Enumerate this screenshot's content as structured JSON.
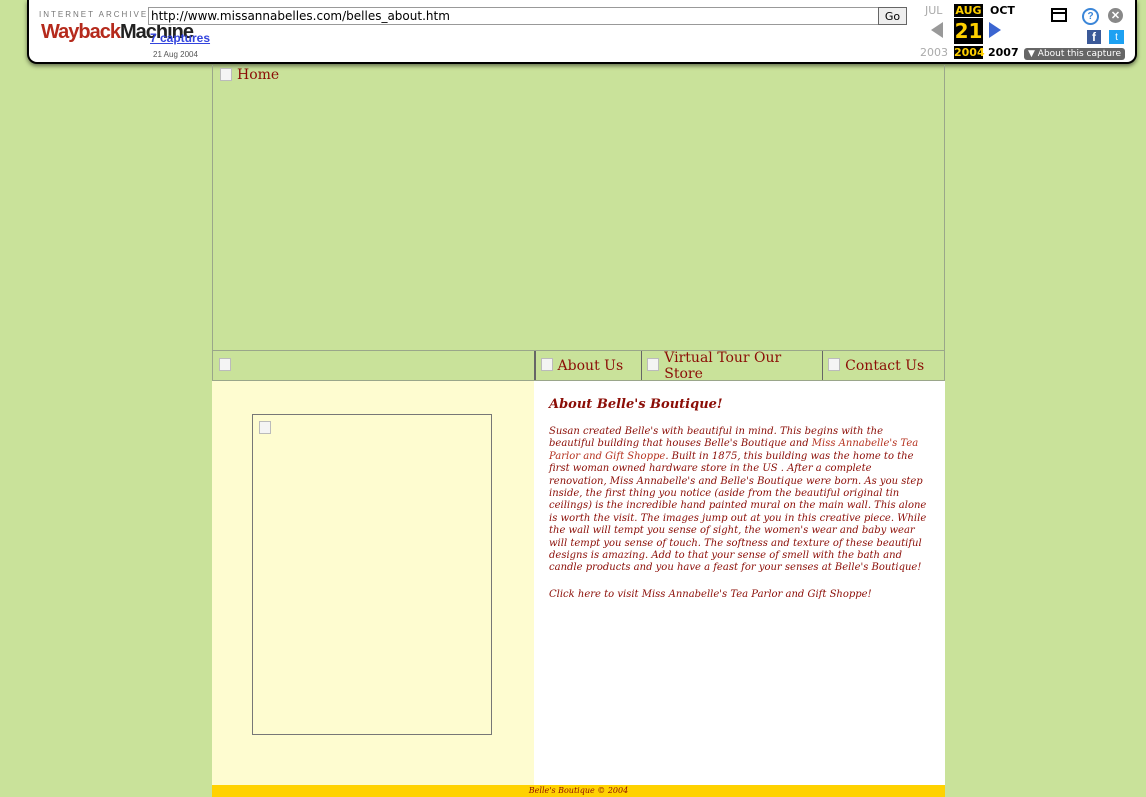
{
  "wayback": {
    "ia_label": "INTERNET ARCHIVE",
    "logo_wayback": "Wayback",
    "logo_machine": "Machine",
    "url": "http://www.missannabelles.com/belles_about.htm",
    "go_label": "Go",
    "captures_link": "7 captures",
    "capture_date": "21 Aug 2004",
    "calendar": {
      "prev_month": "JUL",
      "current_month": "AUG",
      "next_month": "OCT",
      "day": "21",
      "prev_year": "2003",
      "current_year": "2004",
      "next_year": "2007"
    },
    "about_capture": "▼ About this capture",
    "icons": {
      "calendar": "calendar-icon",
      "help": "?",
      "close": "✕",
      "facebook": "f",
      "twitter": "t"
    }
  },
  "site": {
    "home_link": "Home",
    "nav": {
      "about": "About Us",
      "tour": "Virtual Tour Our Store",
      "contact": "Contact Us"
    },
    "about": {
      "title": "About Belle's Boutique!",
      "para_start": "Susan created Belle's with beautiful in mind. This begins with the beautiful building that houses Belle's Boutique and ",
      "para_link": "Miss Annabelle's Tea Parlor and Gift Shoppe",
      "para_end": ". Built in 1875, this building was the home to the first woman owned hardware store in the US . After a complete renovation, Miss Annabelle's and Belle's Boutique were born. As you step inside, the first thing you notice (aside from the beautiful original tin ceilings) is the incredible hand painted mural on the main wall. This alone is worth the visit. The images jump out at you in this creative piece. While the wall will tempt you sense of sight, the women's wear and baby wear will tempt you sense of touch. The softness and texture of these beautiful designs is amazing. Add to that your sense of smell with the bath and candle products and you have a feast for your senses at Belle's Boutique!",
      "visit_link": "Click here to visit Miss Annabelle's Tea Parlor and Gift Shoppe!"
    },
    "footer": "Belle's Boutique © 2004"
  }
}
